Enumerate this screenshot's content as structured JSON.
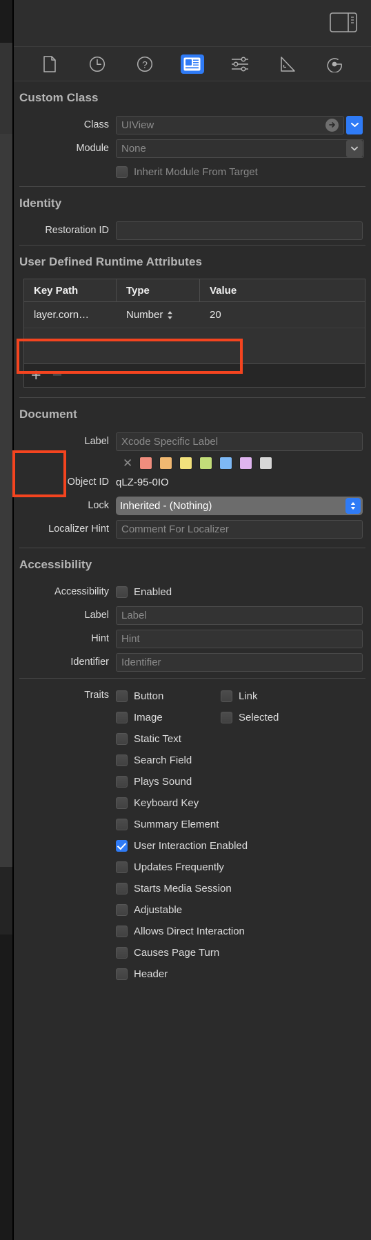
{
  "window": {
    "panel_toggle_icon": "right-panel-toggle-icon"
  },
  "inspector_tabs": [
    {
      "name": "file-inspector",
      "icon": "document-icon",
      "active": false
    },
    {
      "name": "history-inspector",
      "icon": "clock-icon",
      "active": false
    },
    {
      "name": "quick-help-inspector",
      "icon": "question-mark-icon",
      "active": false
    },
    {
      "name": "identity-inspector",
      "icon": "identity-card-icon",
      "active": true
    },
    {
      "name": "attributes-inspector",
      "icon": "sliders-icon",
      "active": false
    },
    {
      "name": "size-inspector",
      "icon": "ruler-triangle-icon",
      "active": false
    },
    {
      "name": "connections-inspector",
      "icon": "connections-arrow-icon",
      "active": false
    }
  ],
  "custom_class": {
    "title": "Custom Class",
    "class_label": "Class",
    "class_value": "UIView",
    "module_label": "Module",
    "module_value": "None",
    "inherit_label": "Inherit Module From Target",
    "inherit_checked": false
  },
  "identity": {
    "title": "Identity",
    "restoration_id_label": "Restoration ID",
    "restoration_id_value": ""
  },
  "runtime_attributes": {
    "title": "User Defined Runtime Attributes",
    "columns": [
      "Key Path",
      "Type",
      "Value"
    ],
    "rows": [
      {
        "key_path": "layer.corn…",
        "type": "Number",
        "value": "20"
      }
    ],
    "add_button": "+",
    "remove_button": "−"
  },
  "document": {
    "title": "Document",
    "label_label": "Label",
    "label_placeholder": "Xcode Specific Label",
    "label_value": "",
    "clear_color_glyph": "✕",
    "colors": [
      "#ef8d7d",
      "#f0b871",
      "#f2e17c",
      "#c2dd79",
      "#7db8f5",
      "#dfb4ef",
      "#d6d6d6"
    ],
    "object_id_label": "Object ID",
    "object_id_value": "qLZ-95-0IO",
    "lock_label": "Lock",
    "lock_value": "Inherited - (Nothing)",
    "localizer_hint_label": "Localizer Hint",
    "localizer_hint_placeholder": "Comment For Localizer",
    "localizer_hint_value": ""
  },
  "accessibility": {
    "title": "Accessibility",
    "accessibility_label": "Accessibility",
    "enabled_label": "Enabled",
    "enabled_checked": false,
    "label_label": "Label",
    "label_placeholder": "Label",
    "hint_label": "Hint",
    "hint_placeholder": "Hint",
    "identifier_label": "Identifier",
    "identifier_placeholder": "Identifier",
    "traits_label": "Traits",
    "traits": [
      {
        "label": "Button",
        "checked": false
      },
      {
        "label": "Link",
        "checked": false
      },
      {
        "label": "Image",
        "checked": false
      },
      {
        "label": "Selected",
        "checked": false
      },
      {
        "label": "Static Text",
        "checked": false
      },
      {
        "label": "Search Field",
        "checked": false
      },
      {
        "label": "Plays Sound",
        "checked": false
      },
      {
        "label": "Keyboard Key",
        "checked": false
      },
      {
        "label": "Summary Element",
        "checked": false
      },
      {
        "label": "User Interaction Enabled",
        "checked": true
      },
      {
        "label": "Updates Frequently",
        "checked": false
      },
      {
        "label": "Starts Media Session",
        "checked": false
      },
      {
        "label": "Adjustable",
        "checked": false
      },
      {
        "label": "Allows Direct Interaction",
        "checked": false
      },
      {
        "label": "Causes Page Turn",
        "checked": false
      },
      {
        "label": "Header",
        "checked": false
      }
    ]
  },
  "theme": {
    "accent": "#2f7bf6",
    "annotation": "#f4441f",
    "panel_bg": "#2b2b2b"
  }
}
